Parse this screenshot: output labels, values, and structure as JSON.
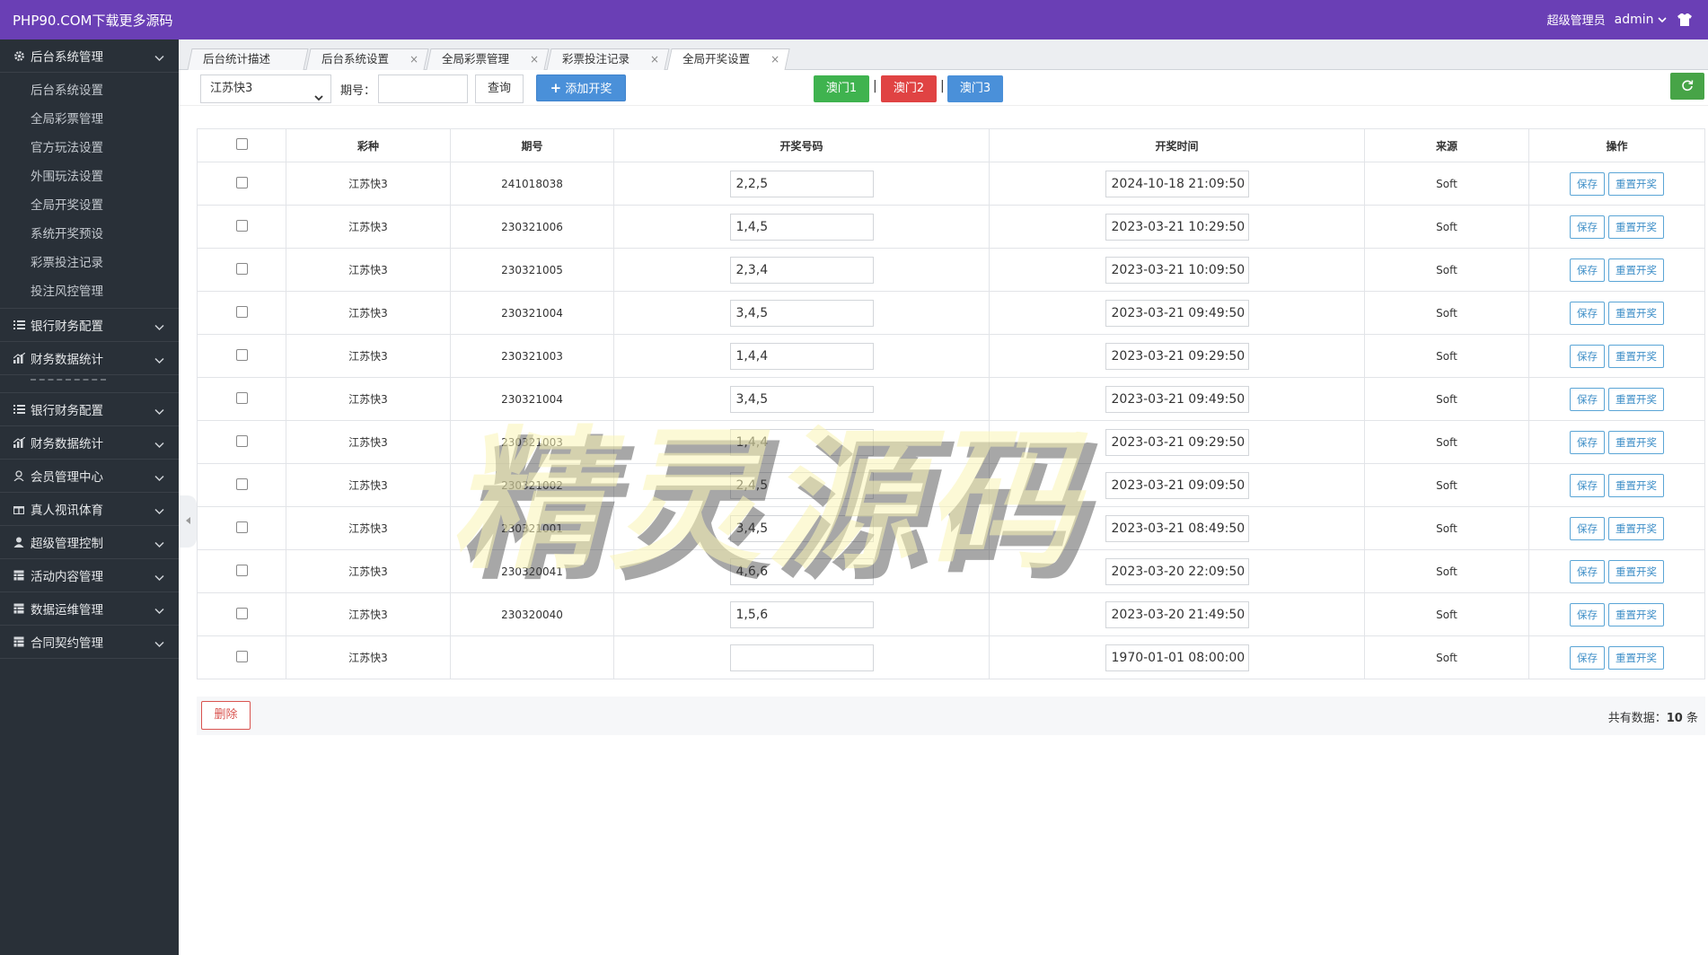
{
  "header": {
    "brand": "PHP90.COM下载更多源码",
    "role": "超级管理员",
    "username": "admin"
  },
  "sidebar": {
    "group_main": {
      "label": "后台系统管理",
      "icon": "gear-icon"
    },
    "sub_items": [
      "后台系统设置",
      "全局彩票管理",
      "官方玩法设置",
      "外围玩法设置",
      "全局开奖设置",
      "系统开奖预设",
      "彩票投注记录",
      "投注风控管理"
    ],
    "groups": [
      {
        "label": "银行财务配置",
        "icon": "list-icon"
      },
      {
        "label": "财务数据统计",
        "icon": "chart-icon"
      },
      {
        "label": "银行财务配置",
        "icon": "list-icon"
      },
      {
        "label": "财务数据统计",
        "icon": "chart-icon"
      },
      {
        "label": "会员管理中心",
        "icon": "user-icon"
      },
      {
        "label": "真人视讯体育",
        "icon": "gift-icon"
      },
      {
        "label": "超级管理控制",
        "icon": "user-icon"
      },
      {
        "label": "活动内容管理",
        "icon": "table-icon"
      },
      {
        "label": "数据运维管理",
        "icon": "table-icon"
      },
      {
        "label": "合同契约管理",
        "icon": "table-icon"
      }
    ]
  },
  "tabs": [
    {
      "label": "后台统计描述"
    },
    {
      "label": "后台系统设置"
    },
    {
      "label": "全局彩票管理"
    },
    {
      "label": "彩票投注记录"
    },
    {
      "label": "全局开奖设置"
    }
  ],
  "toolbar": {
    "lottery_select": "江苏快3",
    "issue_label": "期号：",
    "issue_value": "",
    "query_label": "查询",
    "add_label": "添加开奖",
    "macau1": "澳门1",
    "macau2": "澳门2",
    "macau3": "澳门3",
    "colors": {
      "macau1": "#3fb34f",
      "macau2": "#e04343",
      "macau3": "#4a90d9"
    }
  },
  "table": {
    "headers": [
      "彩种",
      "期号",
      "开奖号码",
      "开奖时间",
      "来源",
      "操作"
    ],
    "save_label": "保存",
    "redraw_label": "重置开奖",
    "rows": [
      {
        "lottery": "江苏快3",
        "issue": "241018038",
        "numbers": "2,2,5",
        "time": "2024-10-18 21:09:50",
        "source": "Soft"
      },
      {
        "lottery": "江苏快3",
        "issue": "230321006",
        "numbers": "1,4,5",
        "time": "2023-03-21 10:29:50",
        "source": "Soft"
      },
      {
        "lottery": "江苏快3",
        "issue": "230321005",
        "numbers": "2,3,4",
        "time": "2023-03-21 10:09:50",
        "source": "Soft"
      },
      {
        "lottery": "江苏快3",
        "issue": "230321004",
        "numbers": "3,4,5",
        "time": "2023-03-21 09:49:50",
        "source": "Soft"
      },
      {
        "lottery": "江苏快3",
        "issue": "230321003",
        "numbers": "1,4,4",
        "time": "2023-03-21 09:29:50",
        "source": "Soft"
      },
      {
        "lottery": "江苏快3",
        "issue": "230321004",
        "numbers": "3,4,5",
        "time": "2023-03-21 09:49:50",
        "source": "Soft"
      },
      {
        "lottery": "江苏快3",
        "issue": "230321003",
        "numbers": "1,4,4",
        "time": "2023-03-21 09:29:50",
        "source": "Soft"
      },
      {
        "lottery": "江苏快3",
        "issue": "230321002",
        "numbers": "2,4,5",
        "time": "2023-03-21 09:09:50",
        "source": "Soft"
      },
      {
        "lottery": "江苏快3",
        "issue": "230321001",
        "numbers": "3,4,5",
        "time": "2023-03-21 08:49:50",
        "source": "Soft"
      },
      {
        "lottery": "江苏快3",
        "issue": "230320041",
        "numbers": "4,6,6",
        "time": "2023-03-20 22:09:50",
        "source": "Soft"
      },
      {
        "lottery": "江苏快3",
        "issue": "230320040",
        "numbers": "1,5,6",
        "time": "2023-03-20 21:49:50",
        "source": "Soft"
      },
      {
        "lottery": "江苏快3",
        "issue": "",
        "numbers": "",
        "time": "1970-01-01 08:00:00",
        "source": "Soft"
      }
    ]
  },
  "footer": {
    "delete_label": "删除",
    "total_prefix": "共有数据：",
    "total_count": "10",
    "total_suffix": " 条"
  },
  "watermark": "精灵源码"
}
